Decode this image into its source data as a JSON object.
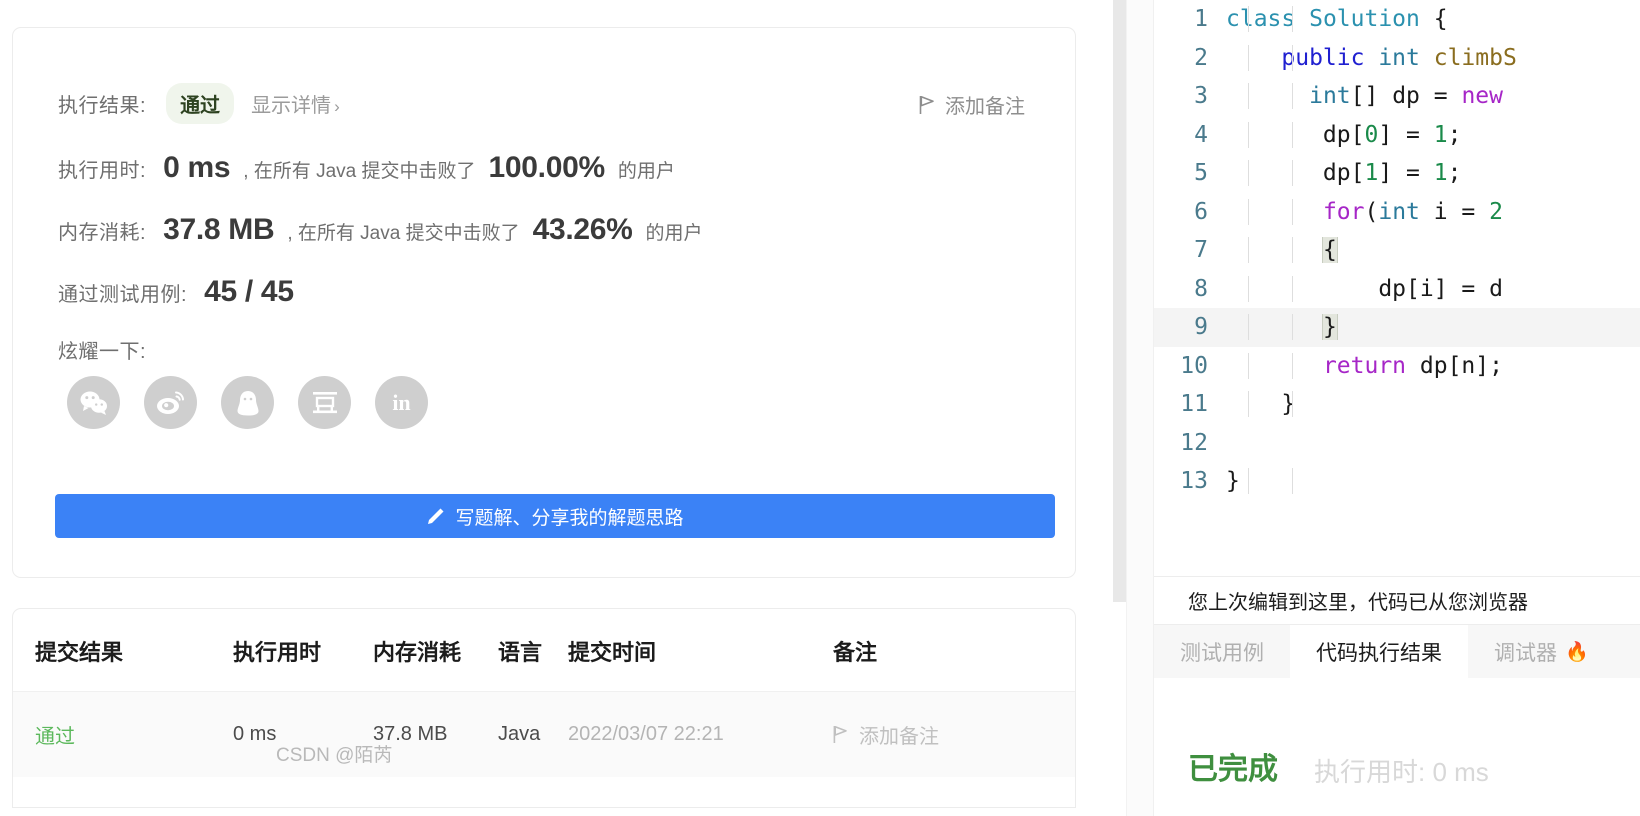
{
  "result_card": {
    "result_label": "执行结果:",
    "status_badge": "通过",
    "show_detail": "显示详情",
    "chevron": "›",
    "add_note": "添加备注",
    "runtime_label": "执行用时:",
    "runtime_value": "0 ms",
    "runtime_mid": ", 在所有 Java 提交中击败了",
    "runtime_percent": "100.00%",
    "runtime_suffix": "的用户",
    "memory_label": "内存消耗:",
    "memory_value": "37.8 MB",
    "memory_mid": ", 在所有 Java 提交中击败了",
    "memory_percent": "43.26%",
    "memory_suffix": "的用户",
    "testcase_label": "通过测试用例:",
    "testcase_value": "45 / 45",
    "flaunt_label": "炫耀一下:",
    "cta_label": "写题解、分享我的解题思路"
  },
  "socials": [
    {
      "name": "wechat-share-icon",
      "title": "微信"
    },
    {
      "name": "weibo-share-icon",
      "title": "微博"
    },
    {
      "name": "qq-share-icon",
      "title": "QQ"
    },
    {
      "name": "douban-share-icon",
      "title": "豆瓣",
      "glyph": "豆"
    },
    {
      "name": "linkedin-share-icon",
      "title": "LinkedIn",
      "glyph": "in"
    }
  ],
  "submissions": {
    "columns": [
      "提交结果",
      "执行用时",
      "内存消耗",
      "语言",
      "提交时间",
      "备注"
    ],
    "rows": [
      {
        "status": "通过",
        "runtime": "0 ms",
        "memory": "37.8 MB",
        "language": "Java",
        "time": "2022/03/07 22:21",
        "note": "添加备注"
      }
    ]
  },
  "editor": {
    "lines": [
      {
        "num": "1",
        "tokens": [
          {
            "t": "class ",
            "c": "kw-class"
          },
          {
            "t": "Solution",
            "c": "kw-class"
          },
          {
            "t": " {",
            "c": "plain"
          }
        ]
      },
      {
        "num": "2",
        "tokens": [
          {
            "t": "    ",
            "c": "plain"
          },
          {
            "t": "public ",
            "c": "kw-pub"
          },
          {
            "t": "int",
            "c": "kw-type"
          },
          {
            "t": " ",
            "c": "plain"
          },
          {
            "t": "climbS",
            "c": "kw-fn"
          }
        ]
      },
      {
        "num": "3",
        "tokens": [
          {
            "t": "      ",
            "c": "plain"
          },
          {
            "t": "int",
            "c": "kw-type"
          },
          {
            "t": "[] ",
            "c": "plain"
          },
          {
            "t": "dp",
            "c": "plain"
          },
          {
            "t": " = ",
            "c": "plain"
          },
          {
            "t": "new",
            "c": "kw-new"
          }
        ]
      },
      {
        "num": "4",
        "tokens": [
          {
            "t": "       dp[",
            "c": "plain"
          },
          {
            "t": "0",
            "c": "num"
          },
          {
            "t": "] = ",
            "c": "plain"
          },
          {
            "t": "1",
            "c": "num"
          },
          {
            "t": ";",
            "c": "plain"
          }
        ]
      },
      {
        "num": "5",
        "tokens": [
          {
            "t": "       dp[",
            "c": "plain"
          },
          {
            "t": "1",
            "c": "num"
          },
          {
            "t": "] = ",
            "c": "plain"
          },
          {
            "t": "1",
            "c": "num"
          },
          {
            "t": ";",
            "c": "plain"
          }
        ]
      },
      {
        "num": "6",
        "tokens": [
          {
            "t": "       ",
            "c": "plain"
          },
          {
            "t": "for",
            "c": "kw-ctrl"
          },
          {
            "t": "(",
            "c": "plain"
          },
          {
            "t": "int",
            "c": "kw-type"
          },
          {
            "t": " i = ",
            "c": "plain"
          },
          {
            "t": "2",
            "c": "num"
          }
        ]
      },
      {
        "num": "7",
        "tokens": [
          {
            "t": "       ",
            "c": "plain"
          },
          {
            "t": "{",
            "c": "plain",
            "hl": true
          }
        ]
      },
      {
        "num": "8",
        "tokens": [
          {
            "t": "           dp[i] = d",
            "c": "plain"
          }
        ]
      },
      {
        "num": "9",
        "tokens": [
          {
            "t": "       ",
            "c": "plain"
          },
          {
            "t": "}",
            "c": "plain",
            "hl": true
          }
        ],
        "highlight": true
      },
      {
        "num": "10",
        "tokens": [
          {
            "t": "       ",
            "c": "plain"
          },
          {
            "t": "return",
            "c": "kw-ctrl"
          },
          {
            "t": " dp[n];",
            "c": "plain"
          }
        ]
      },
      {
        "num": "11",
        "tokens": [
          {
            "t": "    }",
            "c": "plain"
          }
        ]
      },
      {
        "num": "12",
        "tokens": []
      },
      {
        "num": "13",
        "tokens": [
          {
            "t": "}",
            "c": "plain"
          }
        ]
      }
    ]
  },
  "notice": {
    "text": "您上次编辑到这里，代码已从您浏览器"
  },
  "tabs": [
    {
      "label": "测试用例",
      "active": false,
      "icon": ""
    },
    {
      "label": "代码执行结果",
      "active": true,
      "icon": ""
    },
    {
      "label": "调试器",
      "active": false,
      "icon": "🔥"
    }
  ],
  "run_status": {
    "state": "已完成",
    "runtime": "执行用时: 0 ms"
  },
  "watermark": "CSDN @陌芮",
  "colors": {
    "accent_blue": "#3b82f6",
    "pass_green": "#5cb85c",
    "done_green": "#3f8f3f",
    "badge_bg": "#f0f5ec",
    "badge_text": "#2d4220",
    "muted": "#9b9b9b"
  }
}
